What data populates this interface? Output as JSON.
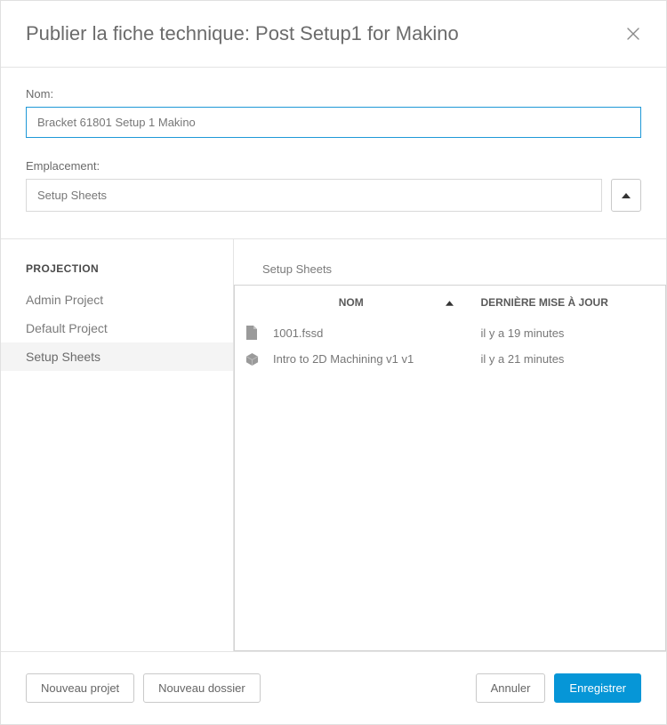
{
  "header": {
    "title": "Publier la fiche technique: Post Setup1 for Makino"
  },
  "form": {
    "name_label": "Nom:",
    "name_value": "Bracket 61801 Setup 1 Makino",
    "location_label": "Emplacement:",
    "location_value": "Setup Sheets"
  },
  "sidebar": {
    "heading": "PROJECTION",
    "items": [
      {
        "label": "Admin Project",
        "selected": false
      },
      {
        "label": "Default Project",
        "selected": false
      },
      {
        "label": "Setup Sheets",
        "selected": true
      }
    ]
  },
  "content": {
    "path": "Setup Sheets",
    "columns": {
      "name": "NOM",
      "updated": "DERNIÈRE MISE À JOUR"
    },
    "rows": [
      {
        "icon": "file",
        "name": "1001.fssd",
        "updated": "il y a 19 minutes"
      },
      {
        "icon": "box",
        "name": "Intro to 2D Machining v1 v1",
        "updated": "il y a 21 minutes"
      }
    ]
  },
  "footer": {
    "new_project": "Nouveau projet",
    "new_folder": "Nouveau dossier",
    "cancel": "Annuler",
    "save": "Enregistrer"
  }
}
